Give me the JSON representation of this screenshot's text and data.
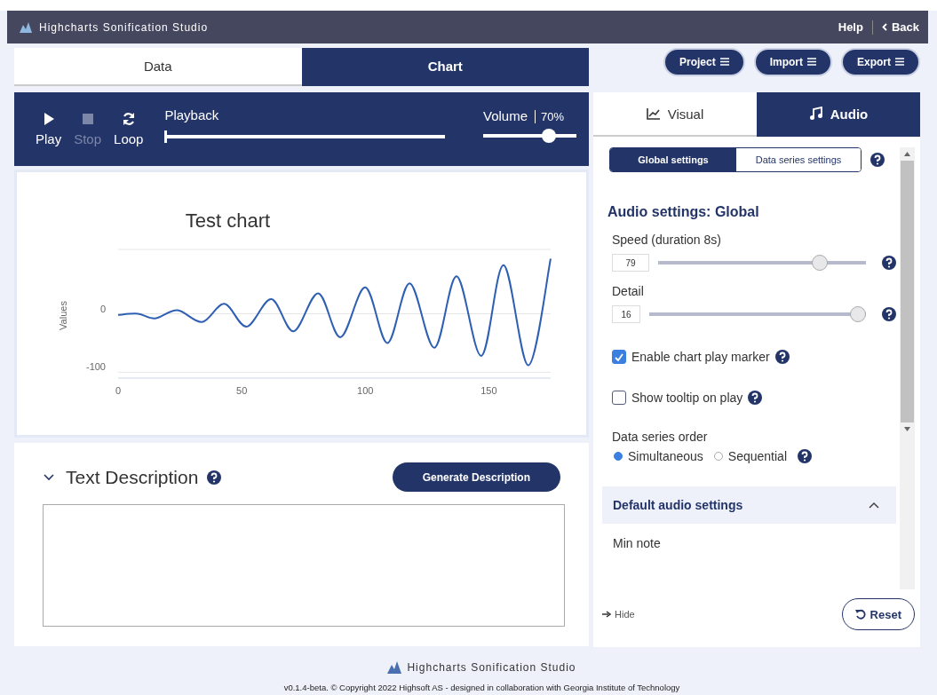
{
  "app_bar": {
    "title": "Highcharts Sonification Studio",
    "links": [
      {
        "kind": "help",
        "label": "Help"
      },
      {
        "kind": "back",
        "label": "Back"
      }
    ]
  },
  "main_tabs": [
    {
      "label": "Data",
      "selected": false
    },
    {
      "label": "Chart",
      "selected": true
    }
  ],
  "menu_buttons": [
    "Project",
    "Import",
    "Export"
  ],
  "player": {
    "controls": [
      {
        "kind": "play",
        "label": "Play",
        "disabled": false
      },
      {
        "kind": "stop",
        "label": "Stop",
        "disabled": true
      },
      {
        "kind": "loop",
        "label": "Loop",
        "disabled": false
      }
    ],
    "playback": {
      "label": "Playback",
      "level": 0
    },
    "volume": {
      "label": "Volume",
      "reading": "70%",
      "level": 0.7
    }
  },
  "chart": {
    "chart_data": {
      "type": "line",
      "title": "Test chart",
      "ylabel": "Values",
      "x": [
        0,
        8,
        15,
        24,
        34,
        43,
        52,
        62,
        71,
        81,
        90,
        100,
        109,
        118,
        128,
        137,
        147,
        156,
        166,
        175
      ],
      "series": [
        {
          "color": "#2f5fb3",
          "values": [
            -2,
            0,
            -8,
            6,
            -14,
            17,
            -22,
            25,
            -30,
            35,
            -40,
            45,
            -50,
            52,
            -58,
            64,
            -72,
            83,
            -88,
            94
          ]
        }
      ],
      "xlim": [
        0,
        175
      ],
      "ylim": [
        -110,
        110
      ],
      "xticks": [
        0,
        50,
        100,
        150
      ],
      "yticks": [
        -100,
        0
      ]
    }
  },
  "text_description": {
    "title": "Text Description",
    "expanded": true,
    "button": "Generate Description"
  },
  "side_tabs": [
    {
      "label": "Visual",
      "kind": "chart",
      "selected": false
    },
    {
      "label": "Audio",
      "kind": "note",
      "selected": true
    }
  ],
  "scope_tabs": [
    {
      "label": "Global settings",
      "selected": true
    },
    {
      "label": "Data series settings",
      "selected": false
    }
  ],
  "heading": "Audio settings: Global",
  "sliders": [
    {
      "label": "Speed (duration 8s)",
      "value": "79",
      "level": 0.8
    },
    {
      "label": "Detail",
      "value": "16",
      "level": 1
    }
  ],
  "checkboxes": [
    {
      "label": "Enable chart play marker",
      "checked": true
    },
    {
      "label": "Show tooltip on play",
      "checked": false
    }
  ],
  "order": {
    "label": "Data series order",
    "options": [
      {
        "label": "Simultaneous",
        "selected": true
      },
      {
        "label": "Sequential",
        "selected": false
      }
    ]
  },
  "section": {
    "title": "Default audio settings",
    "expanded": true,
    "first_field": "Min note"
  },
  "hide": "Hide",
  "reset": "Reset",
  "footer": {
    "brand": "Highcharts Sonification Studio",
    "copyright": "v0.1.4-beta. © Copyright 2022 Highsoft AS - designed in collaboration with Georgia Institute of Technology"
  }
}
